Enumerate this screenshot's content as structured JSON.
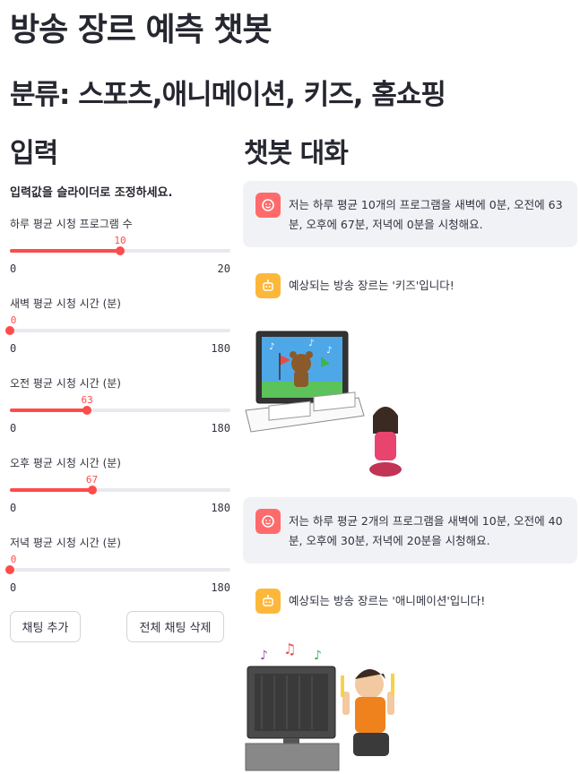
{
  "title": "방송 장르 예측 챗봇",
  "subtitle": "분류: 스포츠,애니메이션, 키즈, 홈쇼핑",
  "left": {
    "heading": "입력",
    "instruction": "입력값을 슬라이더로 조정하세요.",
    "sliders": [
      {
        "label": "하루 평균 시청 프로그램 수",
        "value": "10",
        "min": "0",
        "max": "20",
        "fraction": 0.5
      },
      {
        "label": "새벽 평균 시청 시간 (분)",
        "value": "0",
        "min": "0",
        "max": "180",
        "fraction": 0.0
      },
      {
        "label": "오전 평균 시청 시간 (분)",
        "value": "63",
        "min": "0",
        "max": "180",
        "fraction": 0.35
      },
      {
        "label": "오후 평균 시청 시간 (분)",
        "value": "67",
        "min": "0",
        "max": "180",
        "fraction": 0.372
      },
      {
        "label": "저녁 평균 시청 시간 (분)",
        "value": "0",
        "min": "0",
        "max": "180",
        "fraction": 0.0
      }
    ],
    "add_button": "채팅 추가",
    "clear_button": "전체 채팅 삭제"
  },
  "right": {
    "heading": "챗봇 대화",
    "messages": [
      {
        "role": "user",
        "text": "저는 하루 평균 10개의 프로그램을 새벽에 0분, 오전에 63분, 오후에 67분, 저녁에 0분을 시청해요."
      },
      {
        "role": "assistant",
        "text": "예상되는 방송 장르는 '키즈'입니다!"
      },
      {
        "role": "user",
        "text": "저는 하루 평균 2개의 프로그램을 새벽에 10분, 오전에 40분, 오후에 30분, 저녁에 20분을 시청해요."
      },
      {
        "role": "assistant",
        "text": "예상되는 방송 장르는 '애니메이션'입니다!"
      }
    ]
  },
  "colors": {
    "accent": "#ff4b4b",
    "user_avatar": "#ff6b6b",
    "bot_avatar": "#fdb83b",
    "user_bubble": "#f1f2f6"
  },
  "icons": {
    "user_avatar": "smile-face-icon",
    "bot_avatar": "robot-face-icon"
  }
}
